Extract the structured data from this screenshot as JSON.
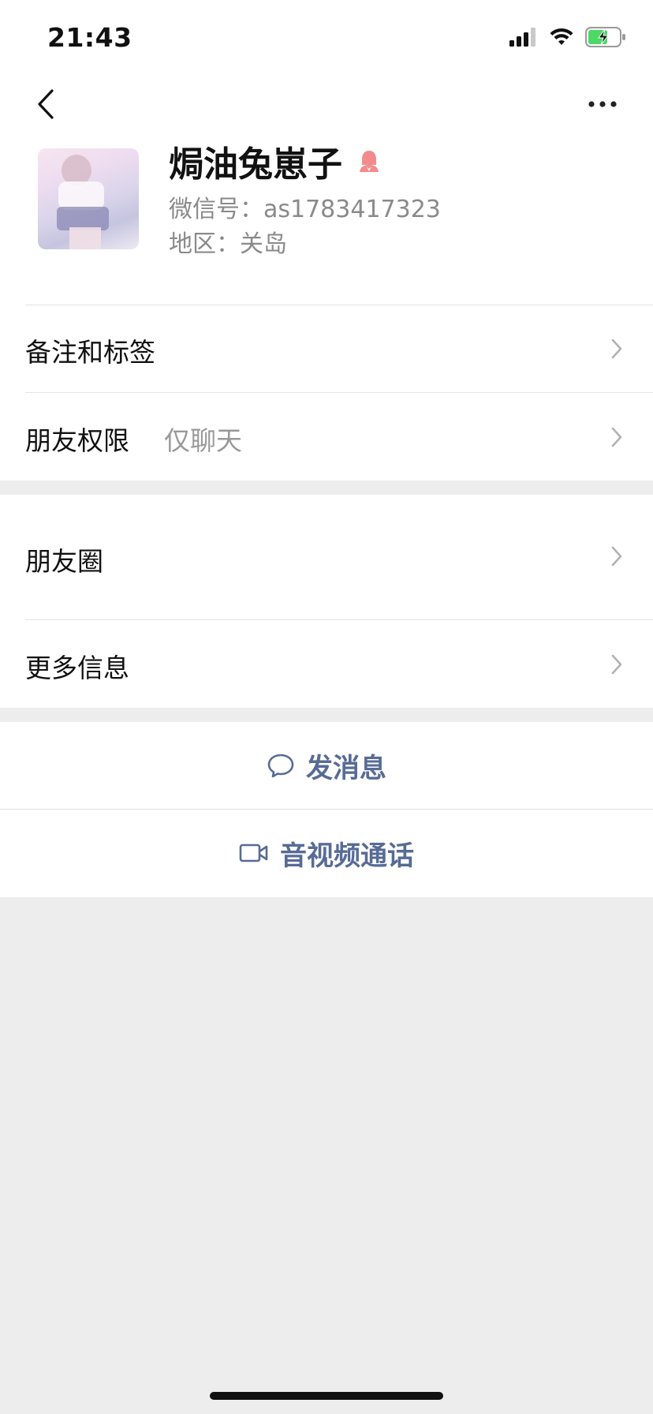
{
  "status_bar": {
    "time": "21:43",
    "icons": [
      "cellular-signal-icon",
      "wifi-icon",
      "battery-charging-icon"
    ]
  },
  "nav": {
    "back_icon": "chevron-left-icon",
    "more_icon": "ellipsis-icon"
  },
  "profile": {
    "name": "焗油兔崽子",
    "gender_icon": "female-icon",
    "wechat_id": "微信号：as1783417323",
    "region": "地区：关岛"
  },
  "cells": {
    "remark_tags": "备注和标签",
    "friend_permissions": "朋友权限",
    "friend_permissions_value": "仅聊天",
    "moments": "朋友圈",
    "more_info": "更多信息"
  },
  "actions": {
    "send_message": "发消息",
    "video_call": "音视频通话"
  },
  "colors": {
    "accent_link": "#576b95",
    "background": "#ededed",
    "female_icon": "#f28c8c",
    "battery_green": "#4cd964"
  }
}
